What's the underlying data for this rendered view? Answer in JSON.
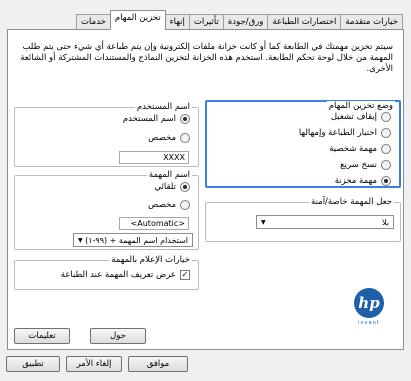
{
  "tabs": [
    {
      "label": "خيارات متقدمة"
    },
    {
      "label": "اختصارات الطباعة"
    },
    {
      "label": "ورق/جودة"
    },
    {
      "label": "تأثيرات"
    },
    {
      "label": "إنهاء"
    },
    {
      "label": "تخزين المهام"
    },
    {
      "label": "خدمات"
    }
  ],
  "intro_text": "سيتم تخزين مهمتك في الطابعة كما أو كانت خزانة ملفات إلكترونية وإن يتم طباعة أي شيء حتى يتم طلب المهمة من خلال لوحة تحكم الطابعة. استخدم هذه الخزانة لتخزين النماذج والمستندات المشتركة أو الشائعة الأخرى.",
  "job_storage_mode": {
    "title": "وضع تخزين المهام",
    "options": [
      "إيقاف تشغيل",
      "اختبار الطباعة وإمهالها",
      "مهمة شخصية",
      "نسخ سريع",
      "مهمة مخزنة"
    ],
    "selected": "مهمة مخزنة"
  },
  "make_job_private": {
    "title": "جعل المهمة خاصة/آمنة",
    "value": "بلا"
  },
  "user_name": {
    "title": "اسم المستخدم",
    "options": [
      "اسم المستخدم",
      "مخصص"
    ],
    "selected": "اسم المستخدم",
    "value": "XXXX"
  },
  "job_name": {
    "title": "اسم المهمة",
    "options": [
      "تلقائي",
      "مخصص"
    ],
    "selected": "تلقائي",
    "value": "<Automatic>",
    "if_exists": "استخدام اسم المهمة + (٩٩-١)"
  },
  "notification": {
    "title": "خيارات الإعلام بالمهمة",
    "checkbox_label": "عرض تعريف المهمة عند الطباعة",
    "checked": true
  },
  "buttons": {
    "about": "حول",
    "help": "تعليمات",
    "ok": "موافق",
    "cancel": "إلغاء الأمر",
    "apply": "تطبيق"
  },
  "logo": {
    "brand": "hp",
    "tagline": "invent"
  }
}
